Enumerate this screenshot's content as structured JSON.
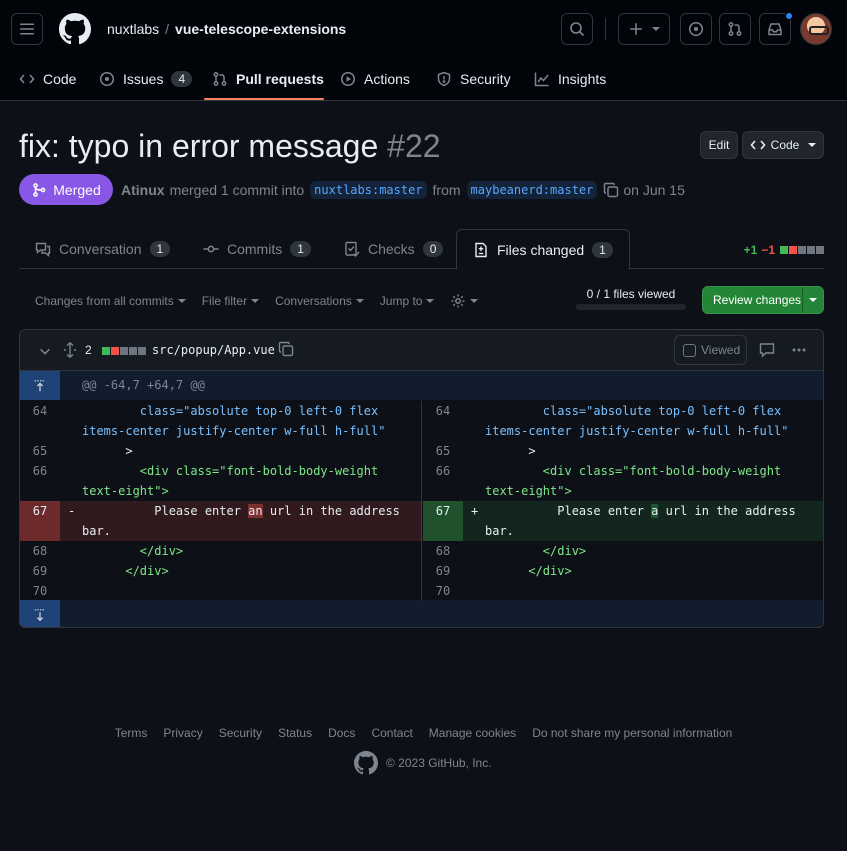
{
  "header": {
    "owner": "nuxtlabs",
    "repo": "vue-telescope-extensions",
    "plus_label": "+"
  },
  "repo_tabs": [
    {
      "label": "Code"
    },
    {
      "label": "Issues",
      "count": "4"
    },
    {
      "label": "Pull requests"
    },
    {
      "label": "Actions"
    },
    {
      "label": "Security"
    },
    {
      "label": "Insights"
    }
  ],
  "pr": {
    "title": "fix: typo in error message",
    "number": "#22",
    "edit_label": "Edit",
    "code_label": "Code",
    "state": "Merged",
    "author": "Atinux",
    "merge_text": "merged 1 commit into",
    "base_branch": "nuxtlabs:master",
    "from_text": "from",
    "head_branch": "maybeanerd:master",
    "date_text": "on Jun 15"
  },
  "pr_tabs": [
    {
      "label": "Conversation",
      "count": "1"
    },
    {
      "label": "Commits",
      "count": "1"
    },
    {
      "label": "Checks",
      "count": "0"
    },
    {
      "label": "Files changed",
      "count": "1"
    }
  ],
  "diffstat": {
    "additions": "+1",
    "deletions": "−1"
  },
  "toolbar": {
    "changes_from": "Changes from all commits",
    "file_filter": "File filter",
    "conversations": "Conversations",
    "jump_to": "Jump to",
    "files_viewed": "0 / 1 files viewed",
    "files_viewed_progress": 0,
    "review_changes": "Review changes"
  },
  "file": {
    "changes_count": "2",
    "path": "src/popup/App.vue",
    "viewed_label": "Viewed",
    "hunk_header": "@@ -64,7 +64,7 @@"
  },
  "diff": {
    "l64a": "64",
    "l64_code": "        class=\"absolute top-0 left-0 flex items-center justify-center w-full h-full\"",
    "l65a": "65",
    "l65_code": "      >",
    "l66a": "66",
    "l66_code": "        <div class=\"font-bold-body-weight text-eight\">",
    "l67a": "67",
    "del_prefix": "          Please enter ",
    "del_word": "an",
    "del_suffix": " url in the address bar.",
    "add_prefix": "          Please enter ",
    "add_word": "a",
    "add_suffix": " url in the address bar.",
    "minus": "-",
    "plus": "+",
    "l68a": "68",
    "l68_code": "        </div>",
    "l69a": "69",
    "l69_code": "      </div>",
    "l70a": "70",
    "l70_code": ""
  },
  "footer": {
    "links": [
      "Terms",
      "Privacy",
      "Security",
      "Status",
      "Docs",
      "Contact",
      "Manage cookies",
      "Do not share my personal information"
    ],
    "copyright": "© 2023 GitHub, Inc."
  },
  "colors": {
    "accent": "#f78166",
    "merged": "#8957e5",
    "review_button": "#238636",
    "addition": "#3fb950",
    "deletion": "#f85149"
  }
}
